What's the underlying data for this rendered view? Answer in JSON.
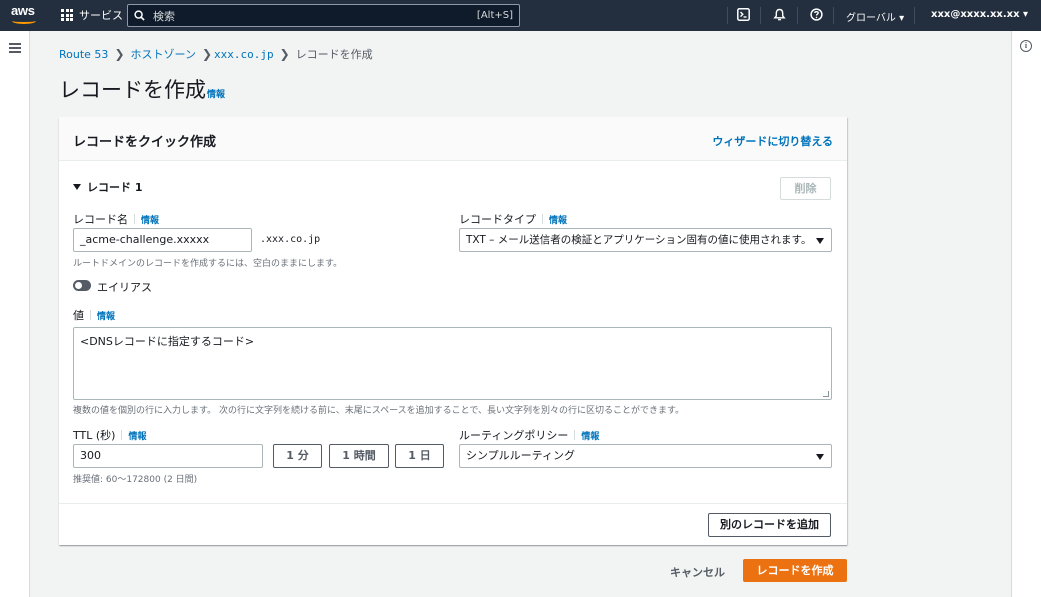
{
  "topnav": {
    "logo_text": "aws",
    "services_label": "サービス",
    "search_placeholder": "検索",
    "search_shortcut": "[Alt+S]",
    "region": "グローバル ▾",
    "account": "xxx@xxxx.xx.xx ▾",
    "icons": [
      "cloudshell-icon",
      "bell-icon",
      "help-icon"
    ]
  },
  "breadcrumb": {
    "items": [
      "Route 53",
      "ホストゾーン",
      "xxx.co.jp",
      "レコードを作成"
    ],
    "separator": "❯"
  },
  "page": {
    "title": "レコードを作成",
    "info": "情報"
  },
  "panel": {
    "title": "レコードをクイック作成",
    "wizard_link": "ウィザードに切り替える",
    "record_header": "レコード 1",
    "delete_button": "削除",
    "record_name": {
      "label": "レコード名",
      "info": "情報",
      "value": "_acme-challenge.xxxxx",
      "suffix": ".xxx.co.jp",
      "hint": "ルートドメインのレコードを作成するには、空白のままにします。"
    },
    "record_type": {
      "label": "レコードタイプ",
      "info": "情報",
      "value": "TXT – メール送信者の検証とアプリケーション固有の値に使用されます。"
    },
    "alias": {
      "label": "エイリアス",
      "enabled": false
    },
    "value": {
      "label": "値",
      "info": "情報",
      "content": "<DNSレコードに指定するコード>",
      "hint": "複数の値を個別の行に入力します。 次の行に文字列を続ける前に、末尾にスペースを追加することで、長い文字列を別々の行に区切ることができます。"
    },
    "ttl": {
      "label": "TTL (秒)",
      "info": "情報",
      "value": "300",
      "presets": [
        "1 分",
        "1 時間",
        "1 日"
      ],
      "hint": "推奨値: 60～172800 (2 日間)"
    },
    "routing": {
      "label": "ルーティングポリシー",
      "info": "情報",
      "value": "シンプルルーティング"
    },
    "add_record_button": "別のレコードを追加"
  },
  "footer": {
    "cancel": "キャンセル",
    "create": "レコードを作成"
  },
  "colors": {
    "nav_bg": "#232f3e",
    "link": "#0073bb",
    "primary": "#ec7211",
    "aws_orange": "#ff9900"
  }
}
